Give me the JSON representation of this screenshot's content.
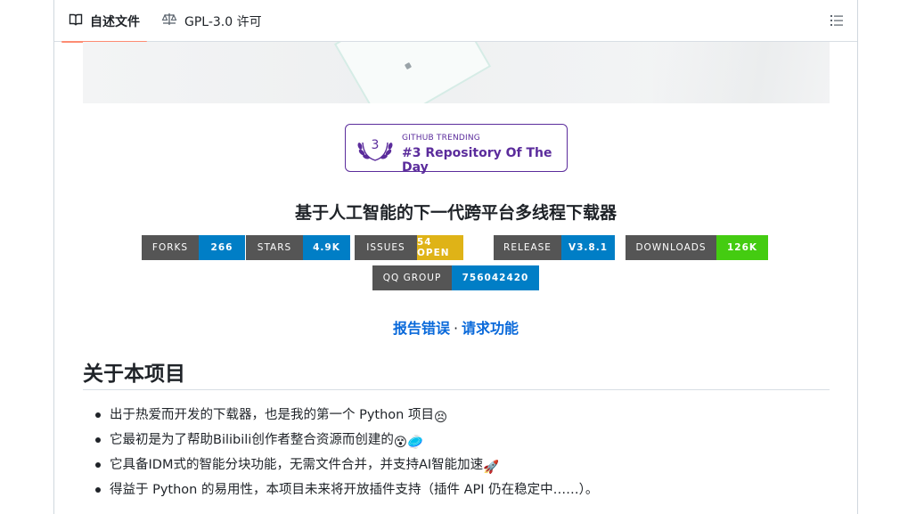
{
  "tabs": {
    "readme_label": "自述文件",
    "readme_icon": "book-icon",
    "license_label": "GPL-3.0 许可",
    "license_icon": "scale-icon",
    "outline_icon": "list-outline-icon"
  },
  "trending": {
    "rank": "3",
    "small_text": "GITHUB TRENDING",
    "big_text": "#3 Repository Of The Day",
    "color": "#5b2c9c"
  },
  "title": "基于人工智能的下一代跨平台多线程下载器",
  "badges": [
    {
      "label": "FORKS",
      "value": "266",
      "color": "#007ec6"
    },
    {
      "label": "STARS",
      "value": "4.9K",
      "color": "#007ec6"
    },
    {
      "label": "ISSUES",
      "value": "54 OPEN",
      "color": "#dfb317"
    },
    {
      "label": "RELEASE",
      "value": "V3.8.1",
      "color": "#007ec6"
    },
    {
      "label": "DOWNLOADS",
      "value": "126K",
      "color": "#4c1"
    },
    {
      "label": "QQ GROUP",
      "value": "756042420",
      "color": "#007ec6"
    }
  ],
  "links": {
    "report": "报告错误",
    "separator": "·",
    "request": "请求功能"
  },
  "about": {
    "heading": "关于本项目",
    "items": [
      {
        "text": "出于热爱而开发的下载器，也是我的第一个 Python 项目",
        "emoji": "😣"
      },
      {
        "text": "它最初是为了帮助Bilibili创作者整合资源而创建的",
        "emoji": "😵🥏"
      },
      {
        "text": "它具备IDM式的智能分块功能，无需文件合并，并支持AI智能加速",
        "emoji": "🚀"
      },
      {
        "text": "得益于 Python 的易用性，本项目未来将开放插件支持（插件 API 仍在稳定中……）。",
        "emoji": ""
      }
    ]
  }
}
